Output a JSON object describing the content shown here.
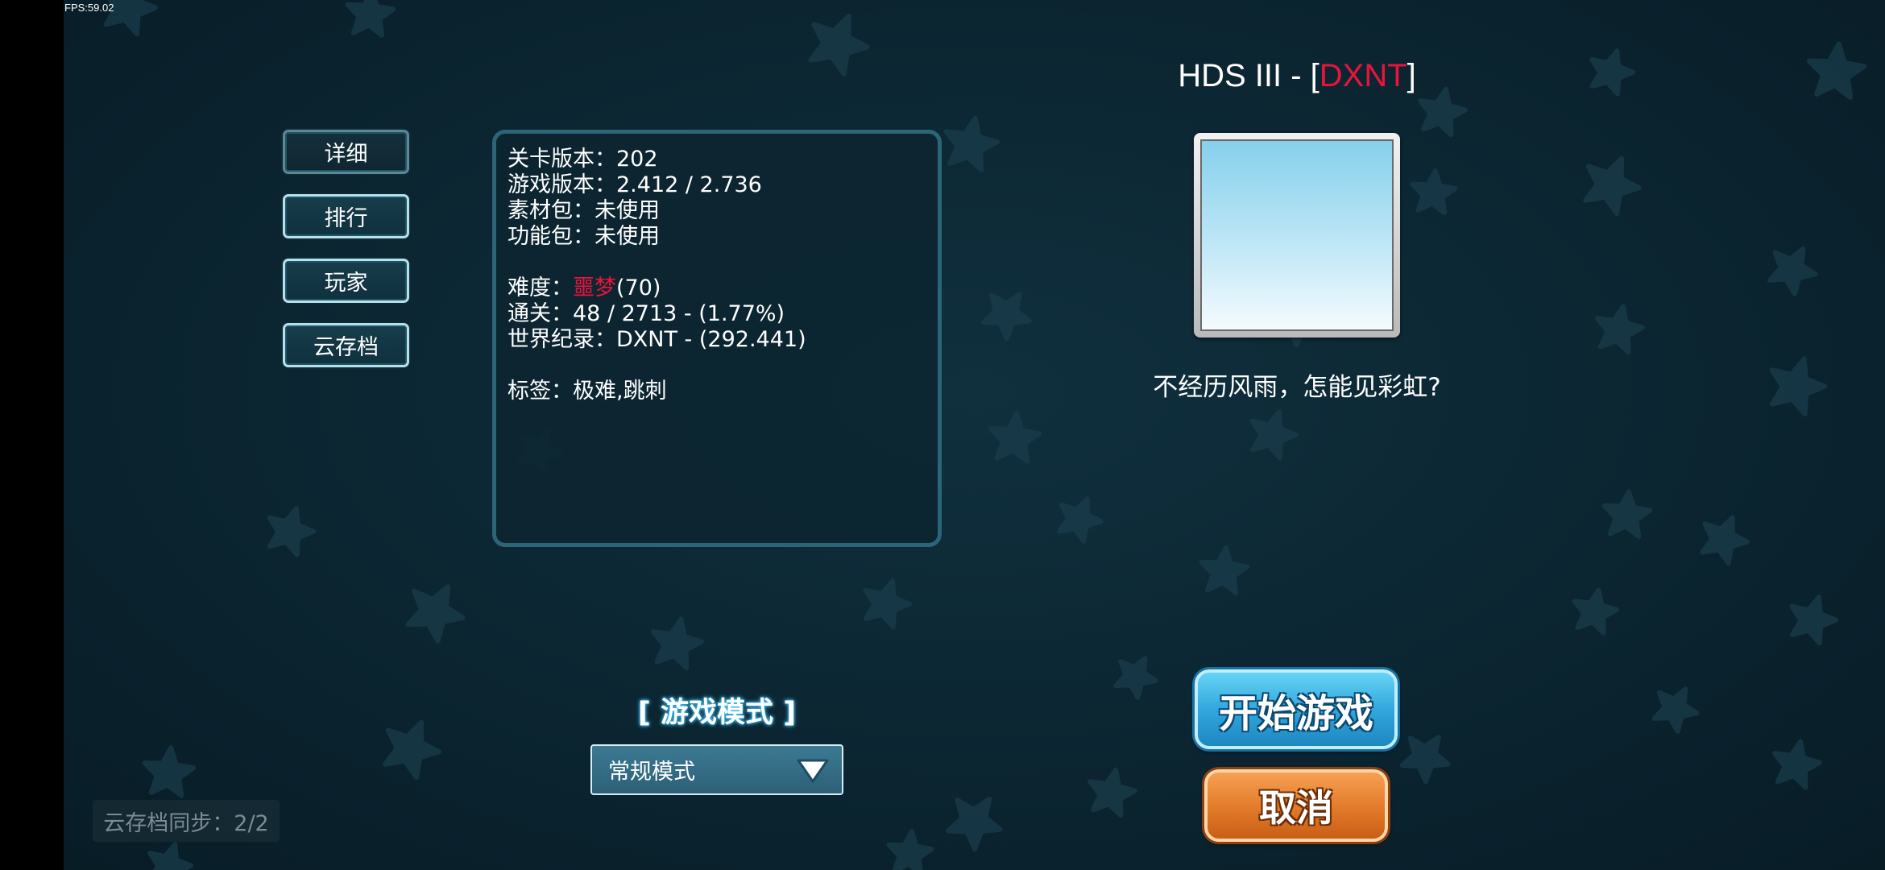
{
  "fps_text": "FPS:59.02",
  "tabs": [
    {
      "label": "详细",
      "active": true
    },
    {
      "label": "排行",
      "active": false
    },
    {
      "label": "玩家",
      "active": false
    },
    {
      "label": "云存档",
      "active": false
    }
  ],
  "info": {
    "level_version_label": "关卡版本：",
    "level_version": "202",
    "game_version_label": "游戏版本：",
    "game_version": "2.412 / 2.736",
    "asset_pack_label": "素材包：",
    "asset_pack": "未使用",
    "feature_pack_label": "功能包：",
    "feature_pack": "未使用",
    "difficulty_label": "难度：",
    "difficulty_name": "噩梦",
    "difficulty_value": "(70)",
    "clears_label": "通关：",
    "clears": "48 / 2713 - (1.77%)",
    "world_record_label": "世界纪录：",
    "world_record": "DXNT - (292.441)",
    "tags_label": "标签：",
    "tags": "极难,跳刺"
  },
  "level": {
    "title_prefix": "HDS III - [",
    "author": "DXNT",
    "title_suffix": "]",
    "description": "不经历风雨，怎能见彩虹?"
  },
  "game_mode": {
    "label": "[ 游戏模式 ]",
    "selected": "常规模式"
  },
  "actions": {
    "start": "开始游戏",
    "cancel": "取消"
  },
  "cloud_sync": "云存档同步：2/2",
  "colors": {
    "accent_red": "#e8143c",
    "start_blue": "#33a7dd",
    "cancel_orange": "#e27a2a"
  }
}
